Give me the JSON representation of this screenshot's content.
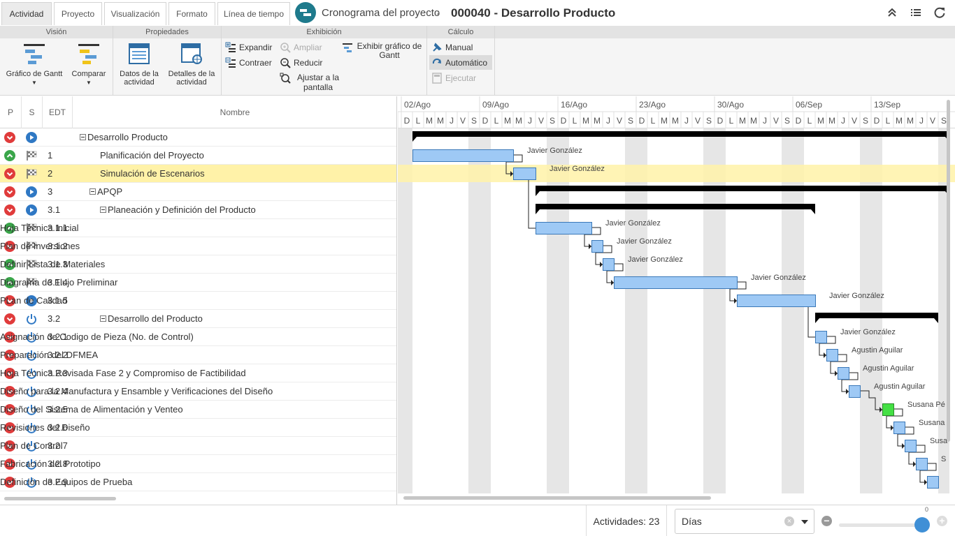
{
  "tabs": [
    {
      "label": "Actividad",
      "active": true
    },
    {
      "label": "Proyecto",
      "active": false
    },
    {
      "label": "Visualización",
      "active": false
    },
    {
      "label": "Formato",
      "active": false
    },
    {
      "label": "Línea de tiempo",
      "active": false
    }
  ],
  "breadcrumb": {
    "parent": "Cronograma del proyecto",
    "separator": "›",
    "current": "000040 - Desarrollo Producto"
  },
  "top_icons": [
    "collapse-up-icon",
    "list-icon",
    "refresh-icon"
  ],
  "ribbon": {
    "groups": [
      "Visión",
      "Propiedades",
      "Exhibición",
      "Cálculo"
    ],
    "vision": {
      "gantt_label": "Gráfico de Gantt",
      "compare_label": "Comparar"
    },
    "propiedades": {
      "activity_data_label": "Datos de la actividad",
      "activity_details_label": "Detalles de la actividad"
    },
    "exhibicion": {
      "expand": "Expandir",
      "collapse": "Contraer",
      "zoom_in": "Ampliar",
      "zoom_out": "Reducir",
      "fit": "Ajustar a la pantalla",
      "show_gantt": "Exhibir gráfico de Gantt"
    },
    "calculo": {
      "manual": "Manual",
      "automatic": "Automático",
      "run": "Ejecutar"
    }
  },
  "grid": {
    "headers": {
      "p": "P",
      "s": "S",
      "edt": "EDT",
      "name": "Nombre"
    },
    "rows": [
      {
        "p": "down",
        "s": "play",
        "edt": "",
        "name": "Desarrollo Producto",
        "level": 0,
        "expandable": true
      },
      {
        "p": "up",
        "s": "flag",
        "edt": "1",
        "name": "Planificación del Proyecto",
        "level": 1,
        "expandable": false
      },
      {
        "p": "down",
        "s": "flag",
        "edt": "2",
        "name": "Simulación de Escenarios",
        "level": 1,
        "expandable": false,
        "selected": true
      },
      {
        "p": "down",
        "s": "play",
        "edt": "3",
        "name": "APQP",
        "level": 1,
        "expandable": true
      },
      {
        "p": "down",
        "s": "play",
        "edt": "3.1",
        "name": "Planeación y Definición del Producto",
        "level": 2,
        "expandable": true
      },
      {
        "p": "up",
        "s": "flag",
        "edt": "3.1.1",
        "name": "Hoja Técnica Inicial",
        "level": 3,
        "expandable": false
      },
      {
        "p": "down",
        "s": "flag",
        "edt": "3.1.2",
        "name": "Plan de Inversiones",
        "level": 3,
        "expandable": false
      },
      {
        "p": "up",
        "s": "flag",
        "edt": "3.1.3",
        "name": "Definir Lista de Materiales",
        "level": 3,
        "expandable": false
      },
      {
        "p": "up",
        "s": "flag",
        "edt": "3.1.4",
        "name": "Diagrama de Flujo Preliminar",
        "level": 3,
        "expandable": false
      },
      {
        "p": "down",
        "s": "play",
        "edt": "3.1.5",
        "name": "PLan de Calidad",
        "level": 3,
        "expandable": false
      },
      {
        "p": "down",
        "s": "power",
        "edt": "3.2",
        "name": "Desarrollo del Producto",
        "level": 2,
        "expandable": true
      },
      {
        "p": "down",
        "s": "power",
        "edt": "3.2.1",
        "name": "Asignación de Codigo de Pieza (No. de Control)",
        "level": 3,
        "expandable": false
      },
      {
        "p": "down",
        "s": "power",
        "edt": "3.2.2",
        "name": "Preparación del DFMEA",
        "level": 3,
        "expandable": false
      },
      {
        "p": "down",
        "s": "power",
        "edt": "3.2.3",
        "name": "Hoja Técnica Revisada Fase 2 y Compromiso de Factibilidad",
        "level": 3,
        "expandable": false
      },
      {
        "p": "down",
        "s": "power",
        "edt": "3.2.4",
        "name": "Diseño para la Manufactura y Ensamble y Verificaciones del Diseño",
        "level": 3,
        "expandable": false
      },
      {
        "p": "down",
        "s": "power",
        "edt": "3.2.5",
        "name": "Diseño del Sistema de Alimentación y Venteo",
        "level": 3,
        "expandable": false
      },
      {
        "p": "down",
        "s": "power",
        "edt": "3.2.6",
        "name": "Revisiones del Diseño",
        "level": 3,
        "expandable": false
      },
      {
        "p": "down",
        "s": "power",
        "edt": "3.2.7",
        "name": "Plan de Control",
        "level": 3,
        "expandable": false
      },
      {
        "p": "down",
        "s": "power",
        "edt": "3.2.8",
        "name": "Fabricación del Prototipo",
        "level": 3,
        "expandable": false
      },
      {
        "p": "down",
        "s": "power",
        "edt": "3.2.9",
        "name": "Definición de Equipos de Prueba",
        "level": 3,
        "expandable": false
      }
    ]
  },
  "gantt": {
    "weeks": [
      "02/Ago",
      "09/Ago",
      "16/Ago",
      "23/Ago",
      "30/Ago",
      "06/Sep",
      "13/Sep"
    ],
    "day_letters": [
      "D",
      "L",
      "M",
      "M",
      "J",
      "V",
      "S"
    ],
    "colors": {
      "bar": "#9ec9f5",
      "bar_border": "#3a78b8",
      "milestone": "#44e044",
      "summary": "#000000",
      "weekend": "#e6e6e6"
    },
    "tasks": [
      {
        "row": 0,
        "type": "summary",
        "start": 1,
        "end": 49
      },
      {
        "row": 1,
        "type": "task",
        "start": 1,
        "end": 10,
        "resource": "Javier González"
      },
      {
        "row": 2,
        "type": "task",
        "start": 10,
        "end": 12,
        "resource": "Javier González"
      },
      {
        "row": 3,
        "type": "summary",
        "start": 12,
        "end": 49
      },
      {
        "row": 4,
        "type": "summary",
        "start": 12,
        "end": 37
      },
      {
        "row": 5,
        "type": "task",
        "start": 12,
        "end": 17,
        "resource": "Javier González"
      },
      {
        "row": 6,
        "type": "task",
        "start": 17,
        "end": 18,
        "resource": "Javier González"
      },
      {
        "row": 7,
        "type": "task",
        "start": 18,
        "end": 19,
        "resource": "Javier González"
      },
      {
        "row": 8,
        "type": "task",
        "start": 19,
        "end": 30,
        "resource": "Javier González"
      },
      {
        "row": 9,
        "type": "task",
        "start": 30,
        "end": 37,
        "resource": "Javier González"
      },
      {
        "row": 10,
        "type": "summary",
        "start": 37,
        "end": 48
      },
      {
        "row": 11,
        "type": "task",
        "start": 37,
        "end": 38,
        "resource": "Javier González"
      },
      {
        "row": 12,
        "type": "task",
        "start": 38,
        "end": 39,
        "resource": "Agustin Aguilar"
      },
      {
        "row": 13,
        "type": "task",
        "start": 39,
        "end": 40,
        "resource": "Agustin Aguilar"
      },
      {
        "row": 14,
        "type": "task",
        "start": 40,
        "end": 41,
        "resource": "Agustin Aguilar"
      },
      {
        "row": 15,
        "type": "milestone",
        "start": 43,
        "end": 44,
        "resource": "Susana Pé"
      },
      {
        "row": 16,
        "type": "task",
        "start": 44,
        "end": 45,
        "resource": "Susana"
      },
      {
        "row": 17,
        "type": "task",
        "start": 45,
        "end": 46,
        "resource": "Susa"
      },
      {
        "row": 18,
        "type": "task",
        "start": 46,
        "end": 47,
        "resource": "S"
      },
      {
        "row": 19,
        "type": "task",
        "start": 47,
        "end": 48,
        "resource": ""
      }
    ]
  },
  "status": {
    "activities": "Actividades: 23",
    "scale": "Días",
    "zoom": "0",
    "clear": "×",
    "minus": "−",
    "plus": "+"
  }
}
